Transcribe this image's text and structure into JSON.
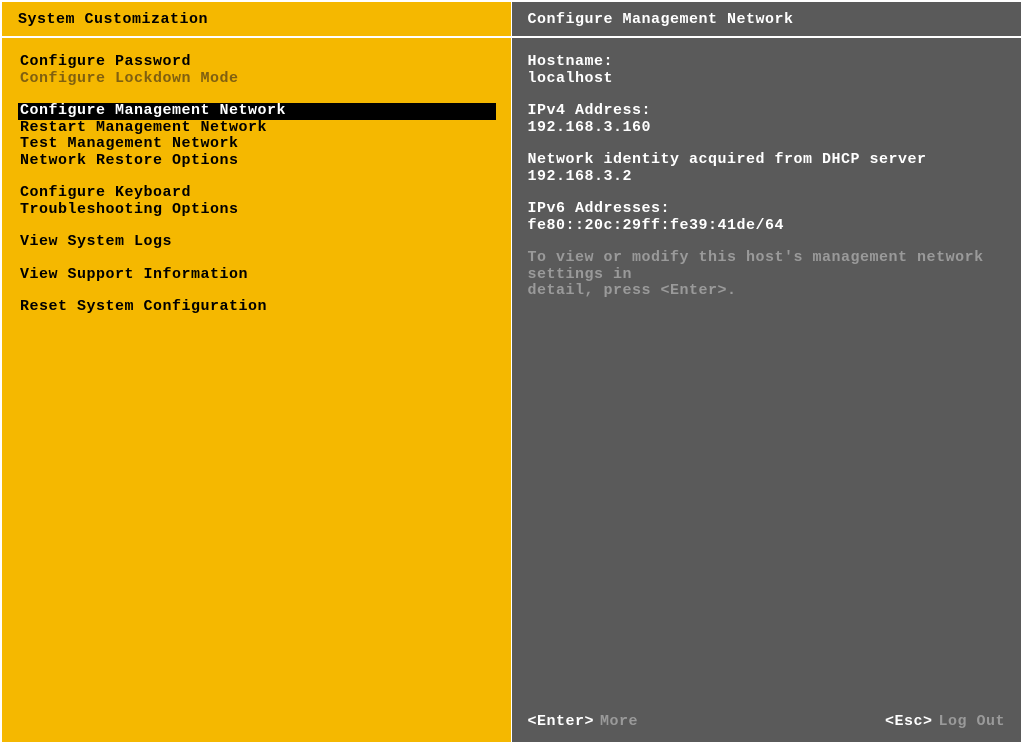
{
  "left": {
    "title": "System Customization",
    "groups": [
      [
        {
          "label": "Configure Password",
          "state": "normal"
        },
        {
          "label": "Configure Lockdown Mode",
          "state": "disabled"
        }
      ],
      [
        {
          "label": "Configure Management Network",
          "state": "selected"
        },
        {
          "label": "Restart Management Network",
          "state": "normal"
        },
        {
          "label": "Test Management Network",
          "state": "normal"
        },
        {
          "label": "Network Restore Options",
          "state": "normal"
        }
      ],
      [
        {
          "label": "Configure Keyboard",
          "state": "normal"
        },
        {
          "label": "Troubleshooting Options",
          "state": "normal"
        }
      ],
      [
        {
          "label": "View System Logs",
          "state": "normal"
        }
      ],
      [
        {
          "label": "View Support Information",
          "state": "normal"
        }
      ],
      [
        {
          "label": "Reset System Configuration",
          "state": "normal"
        }
      ]
    ]
  },
  "right": {
    "title": "Configure Management Network",
    "hostname_label": "Hostname:",
    "hostname_value": "localhost",
    "ipv4_label": "IPv4 Address:",
    "ipv4_value": "192.168.3.160",
    "dhcp_note": "Network identity acquired from DHCP server 192.168.3.2",
    "ipv6_label": "IPv6 Addresses:",
    "ipv6_value": "fe80::20c:29ff:fe39:41de/64",
    "help_line1": "To view or modify this host's management network settings in",
    "help_line2": "detail, press <Enter>.",
    "footer": {
      "enter_key": "<Enter>",
      "enter_action": "More",
      "esc_key": "<Esc>",
      "esc_action": "Log Out"
    }
  }
}
